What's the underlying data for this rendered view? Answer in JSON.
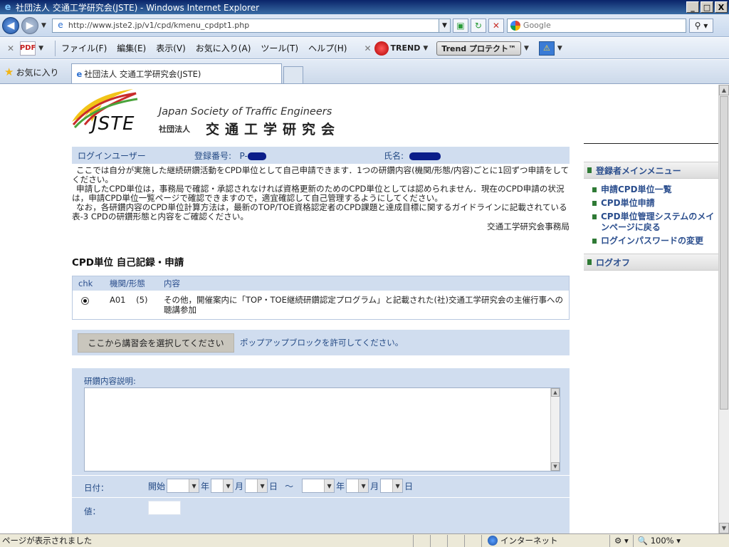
{
  "window": {
    "title": "社団法人 交通工学研究会(JSTE) - Windows Internet Explorer",
    "minimize": "_",
    "maximize": "□",
    "close": "X"
  },
  "address": {
    "url": "http://www.jste2.jp/v1/cpd/kmenu_cpdpt1.php",
    "search_placeholder": "Google"
  },
  "menu": {
    "items": [
      "ファイル(F)",
      "編集(E)",
      "表示(V)",
      "お気に入り(A)",
      "ツール(T)",
      "ヘルプ(H)"
    ],
    "trend": "TREND",
    "trend_protect": "Trend プロテクト™"
  },
  "tabs": {
    "favorites": "お気に入り",
    "active_tab": "社団法人 交通工学研究会(JSTE)"
  },
  "logo": {
    "abbr": "JSTE",
    "english": "Japan Society of Traffic Engineers",
    "corp": "社団法人",
    "japanese": "交通工学研究会"
  },
  "userbar": {
    "login_user": "ログインユーザー",
    "reg_no_label": "登録番号:",
    "reg_no_prefix": "P-",
    "name_label": "氏名:"
  },
  "intro": {
    "p1": "ここでは自分が実施した継続研鑽活動をCPD単位として自己申請できます．1つの研鑽内容(機関/形態/内容)ごとに1回ずつ申請をしてください。",
    "p2": "申請したCPD単位は，事務局で確認・承認されなければ資格更新のためのCPD単位としては認められません．現在のCPD申請の状況は，申請CPD単位一覧ページで確認できますので，適宜確認して自己管理するようにしてください。",
    "p3": "なお，各研鑽内容のCPD単位計算方法は，最新のTOP/TOE資格認定者のCPD課題と達成目標に関するガイドラインに記載されている表-3 CPDの研鑽形態と内容をご確認ください。",
    "signature": "交通工学研究会事務局"
  },
  "cpd": {
    "section_title": "CPD単位 自己記録・申請",
    "headers": {
      "chk": "chk",
      "org": "機関/形態",
      "content": "内容"
    },
    "row": {
      "code": "A01",
      "form": "(5)",
      "content": "その他，開催案内に「TOP・TOE継続研鑽認定プログラム」と記載された(社)交通工学研究会の主催行事への聴講参加"
    }
  },
  "select": {
    "button": "ここから講習会を選択してください",
    "note": "ポップアップブロックを許可してください。"
  },
  "form": {
    "desc_label": "研鑽内容説明:",
    "date_label": "日付：",
    "start": "開始",
    "year": "年",
    "month": "月",
    "day": "日",
    "tilde": "～",
    "value_label": "値："
  },
  "sidebar": {
    "main_menu": "登録者メインメニュー",
    "links": [
      "申請CPD単位一覧",
      "CPD単位申請",
      "CPD単位管理システムのメインページに戻る",
      "ログインパスワードの変更"
    ],
    "logoff": "ログオフ"
  },
  "status": {
    "message": "ページが表示されました",
    "zone": "インターネット",
    "zoom": "100%"
  }
}
